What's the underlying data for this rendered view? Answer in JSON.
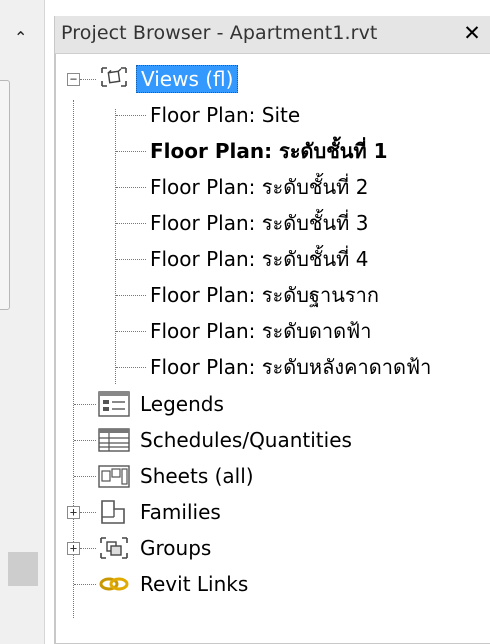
{
  "panel": {
    "title": "Project Browser - Apartment1.rvt",
    "close_glyph": "✕",
    "left_arrow_glyph": "⌃"
  },
  "tree": {
    "views_label": "Views (fl)",
    "view_items": [
      "Floor Plan: Site",
      "Floor Plan: ระดับชั้นที่ 1",
      "Floor Plan: ระดับชั้นที่ 2",
      "Floor Plan: ระดับชั้นที่ 3",
      "Floor Plan: ระดับชั้นที่ 4",
      "Floor Plan: ระดับฐานราก",
      "Floor Plan: ระดับดาดฟ้า",
      "Floor Plan: ระดับหลังคาดาดฟ้า"
    ],
    "legends_label": "Legends",
    "schedules_label": "Schedules/Quantities",
    "sheets_label": "Sheets (all)",
    "families_label": "Families",
    "groups_label": "Groups",
    "links_label": "Revit Links",
    "expand_collapse_glyphs": {
      "collapse": "−",
      "expand": "+"
    }
  },
  "colors": {
    "selection": "#3399ff",
    "link_icon": "#d8a300"
  }
}
